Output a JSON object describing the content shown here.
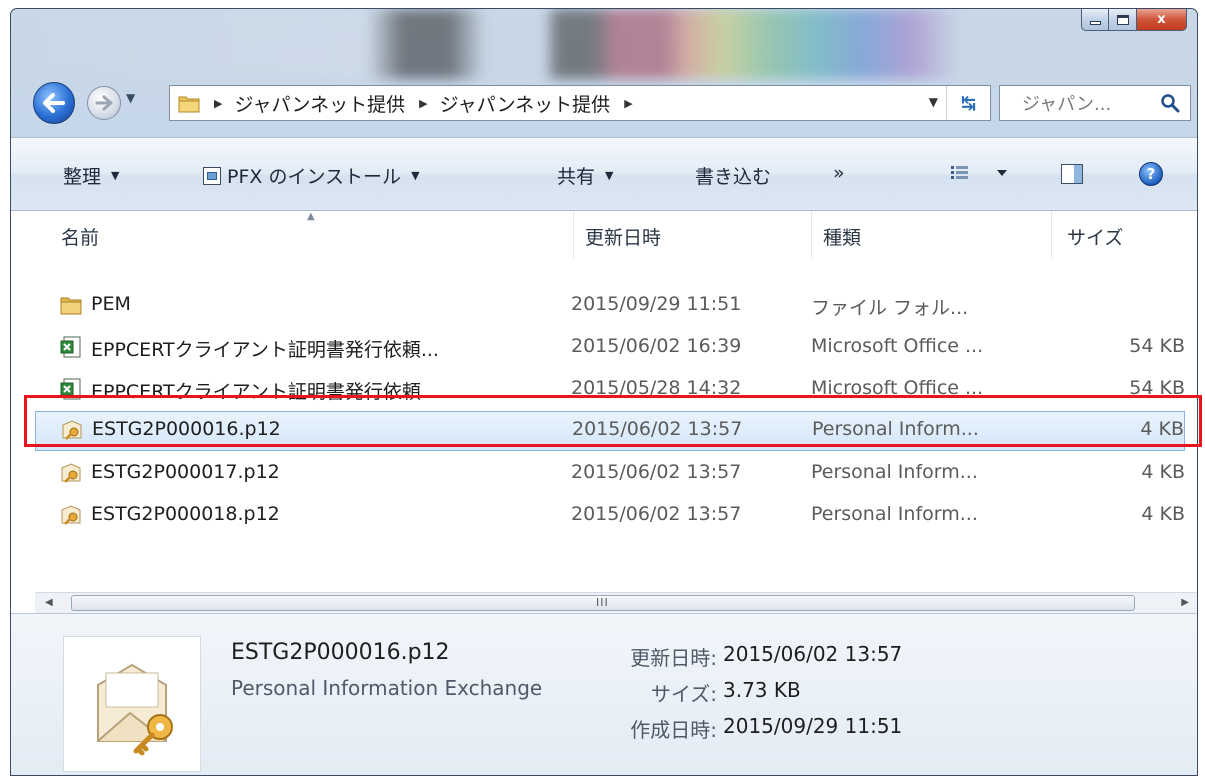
{
  "window": {
    "caption": {
      "minimize": "",
      "maximize": "",
      "close": "x"
    }
  },
  "nav": {
    "breadcrumbs": [
      "ジャパンネット提供",
      "ジャパンネット提供"
    ],
    "search_placeholder": "ジャパン..."
  },
  "toolbar": {
    "organize": "整理",
    "install_pfx": "PFX のインストール",
    "share": "共有",
    "burn": "書き込む",
    "more": "»"
  },
  "columns": {
    "name": "名前",
    "modified": "更新日時",
    "type": "種類",
    "size": "サイズ"
  },
  "files": [
    {
      "name": "PEM",
      "modified": "2015/09/29 11:51",
      "type": "ファイル フォル...",
      "size": "",
      "icon": "folder-icon"
    },
    {
      "name": "EPPCERTクライアント証明書発行依頼...",
      "modified": "2015/06/02 16:39",
      "type": "Microsoft Office ...",
      "size": "54 KB",
      "icon": "excel-icon"
    },
    {
      "name": "EPPCERTクライアント証明書発行依頼...",
      "modified": "2015/05/28 14:32",
      "type": "Microsoft Office ...",
      "size": "54 KB",
      "icon": "excel-icon"
    },
    {
      "name": "ESTG2P000016.p12",
      "modified": "2015/06/02 13:57",
      "type": "Personal Inform...",
      "size": "4 KB",
      "icon": "certificate-icon",
      "selected": true
    },
    {
      "name": "ESTG2P000017.p12",
      "modified": "2015/06/02 13:57",
      "type": "Personal Inform...",
      "size": "4 KB",
      "icon": "certificate-icon"
    },
    {
      "name": "ESTG2P000018.p12",
      "modified": "2015/06/02 13:57",
      "type": "Personal Inform...",
      "size": "4 KB",
      "icon": "certificate-icon"
    }
  ],
  "scrollbar": {
    "grip": "III"
  },
  "details": {
    "name": "ESTG2P000016.p12",
    "type": "Personal Information Exchange",
    "modified_label": "更新日時:",
    "modified_value": "2015/06/02 13:57",
    "size_label": "サイズ:",
    "size_value": "3.73 KB",
    "created_label": "作成日時:",
    "created_value": "2015/09/29 11:51"
  },
  "colors": {
    "highlight": "#e8151c",
    "selection": "#d3e6fa"
  }
}
